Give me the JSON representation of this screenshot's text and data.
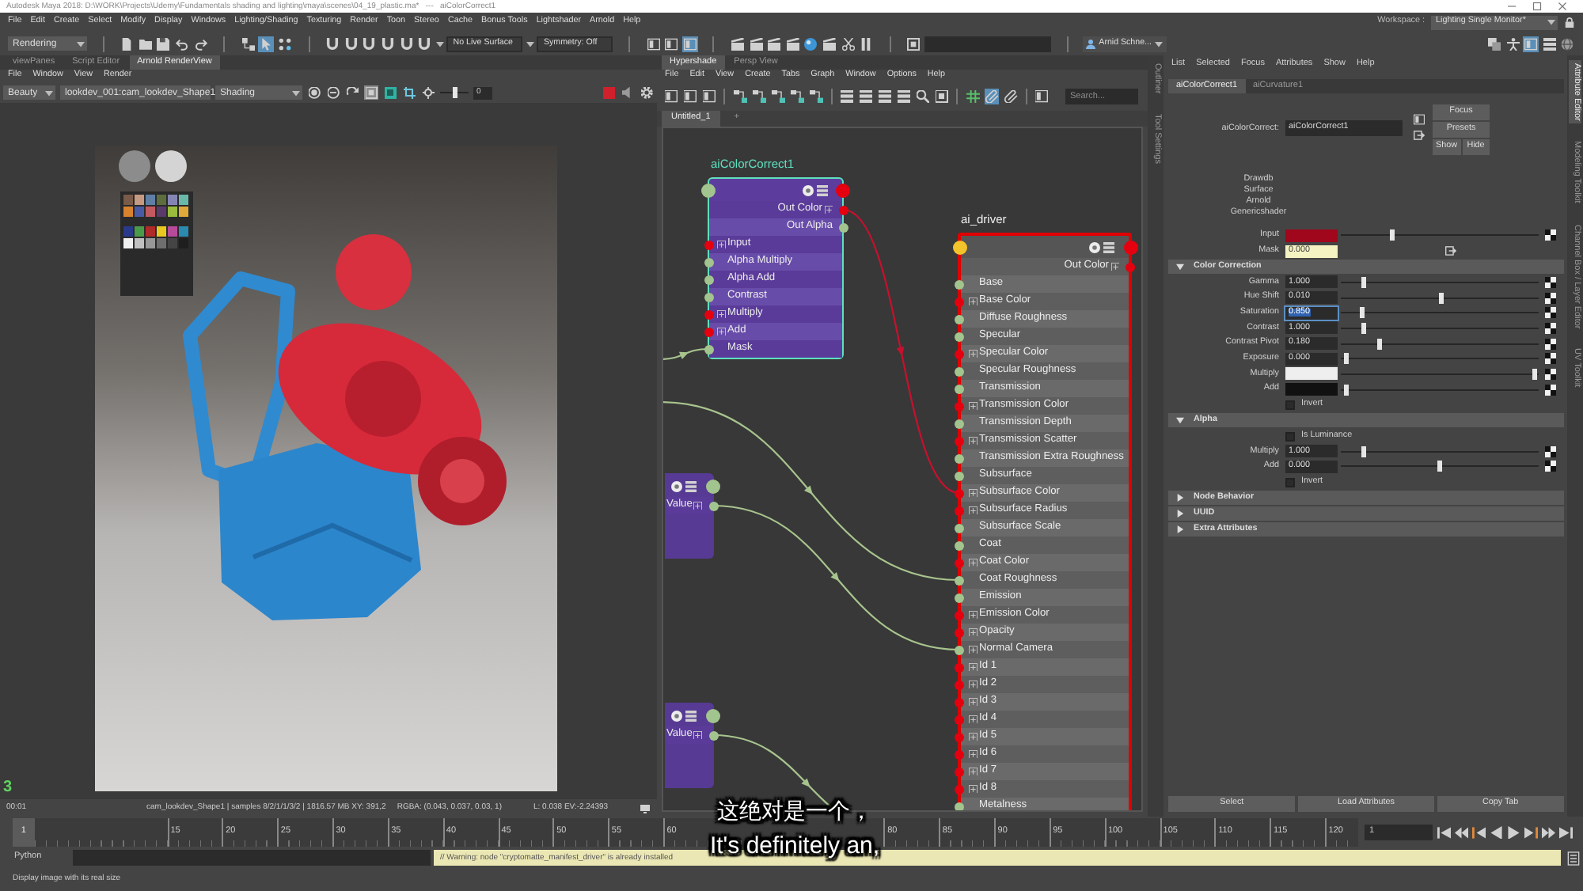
{
  "window": {
    "title": "Autodesk Maya 2018: D:\\WORK\\Projects\\Udemy\\Fundamentals shading and lighting\\maya\\scenes\\04_19_plastic.ma*   ---   aiColorCorrect1"
  },
  "menu_bar": {
    "items": [
      "File",
      "Edit",
      "Create",
      "Select",
      "Modify",
      "Display",
      "Windows",
      "Lighting/Shading",
      "Texturing",
      "Render",
      "Toon",
      "Stereo",
      "Cache",
      "Bonus Tools",
      "Lightshader",
      "Arnold",
      "Help"
    ],
    "workspace_label": "Workspace :",
    "workspace": "Lighting Single Monitor*"
  },
  "toolbar": {
    "groups": [
      [
        {
          "kind": "dropdown",
          "label": "Rendering"
        }
      ],
      [
        {
          "kind": "icon",
          "selected": false
        },
        {
          "kind": "icon",
          "selected": false
        },
        {
          "kind": "icon",
          "selected": false
        },
        {
          "kind": "icon",
          "selected": false
        },
        {
          "kind": "icon",
          "selected": false
        }
      ],
      [
        {
          "kind": "icon",
          "selected": false
        },
        {
          "kind": "icon",
          "selected": true
        },
        {
          "kind": "icon",
          "selected": false
        }
      ],
      [
        {
          "kind": "icon",
          "selected": false
        },
        {
          "kind": "icon",
          "selected": false
        },
        {
          "kind": "icon",
          "selected": false
        },
        {
          "kind": "icon",
          "selected": false
        },
        {
          "kind": "icon",
          "selected": false
        },
        {
          "kind": "icon",
          "selected": false
        },
        {
          "kind": "caret"
        },
        {
          "kind": "field",
          "value": "No Live Surface"
        },
        {
          "kind": "caret"
        },
        {
          "kind": "field",
          "value": "Symmetry: Off"
        }
      ],
      [
        {
          "kind": "icon",
          "selected": false
        },
        {
          "kind": "icon",
          "selected": false
        },
        {
          "kind": "icon",
          "selected": true
        }
      ],
      [
        {
          "kind": "icon",
          "selected": false
        },
        {
          "kind": "icon",
          "selected": false
        },
        {
          "kind": "icon",
          "selected": false
        },
        {
          "kind": "icon",
          "selected": false
        },
        {
          "kind": "icon",
          "selected": false
        },
        {
          "kind": "icon",
          "selected": false
        },
        {
          "kind": "icon",
          "selected": false
        },
        {
          "kind": "icon",
          "selected": false
        }
      ],
      [
        {
          "kind": "icon",
          "selected": false
        },
        {
          "kind": "field"
        }
      ],
      [
        {
          "kind": "account",
          "label": "Arnid Schne..."
        }
      ]
    ],
    "right_icons": [
      {
        "selected": false
      },
      {
        "selected": false
      },
      {
        "selected": true
      },
      {
        "selected": false
      },
      {
        "selected": false
      }
    ]
  },
  "render_view": {
    "tabs": [
      {
        "label": "viewPanes",
        "selected": false
      },
      {
        "label": "Script Editor",
        "selected": false
      },
      {
        "label": "Arnold RenderView",
        "selected": true
      }
    ],
    "menu": [
      "File",
      "Window",
      "View",
      "Render"
    ],
    "toolbar": {
      "aov": "Beauty",
      "camera": "lookdev_001:cam_lookdev_Shape1",
      "channel": "Shading",
      "icons": [
        {
          "selected": false
        },
        {
          "selected": false
        },
        {
          "selected": false
        },
        {
          "selected": true
        },
        {
          "selected": false
        },
        {
          "selected": false
        },
        {
          "selected": false
        }
      ],
      "exposure": {
        "level": 0.5,
        "value": "0"
      },
      "end_icons": [
        {
          "selected": false
        },
        {
          "selected": false
        },
        {
          "selected": false
        }
      ]
    },
    "panel_number": "3",
    "status": {
      "time": "00:01",
      "info": "cam_lookdev_Shape1 | samples 8/2/1/1/3/2 | 1816.57 MB XY: 391,2",
      "rgba": "RGBA: (0.043, 0.037, 0.03, 1)",
      "luminance": "L: 0.038 EV:-2.24393"
    }
  },
  "hypershade": {
    "tabs": [
      {
        "label": "Hypershade",
        "selected": true
      },
      {
        "label": "Persp View",
        "selected": false
      }
    ],
    "menu": [
      "File",
      "Edit",
      "View",
      "Create",
      "Tabs",
      "Graph",
      "Window",
      "Options",
      "Help"
    ],
    "toolbar_icons": [
      {
        "selected": false
      },
      {
        "selected": false
      },
      {
        "selected": false
      },
      {
        "selected": false
      },
      {
        "selected": false
      },
      {
        "selected": false
      },
      {
        "selected": false
      },
      {
        "selected": false
      },
      {
        "selected": false
      },
      {
        "selected": false
      },
      {
        "selected": false
      },
      {
        "selected": false
      },
      {
        "selected": false
      },
      {
        "selected": false
      },
      {
        "selected": false
      },
      {
        "selected": true
      },
      {
        "selected": false
      },
      {
        "selected": false
      }
    ],
    "search": {
      "placeholder": "Search..."
    },
    "graph_tabs": [
      {
        "label": "Untitled_1",
        "selected": true
      },
      {
        "label": "+",
        "selected": false
      }
    ],
    "nodes": [
      {
        "kind": "utility",
        "title": "aiColorCorrect1",
        "color": "#5fe0bf",
        "outputs": [
          {
            "label": "Out Color",
            "kind": "color",
            "expandable": true
          },
          {
            "label": "Out Alpha",
            "kind": "float",
            "expandable": false
          }
        ],
        "inputs": [
          {
            "label": "Input",
            "kind": "color",
            "expandable": true
          },
          {
            "label": "Alpha Multiply",
            "kind": "float",
            "expandable": false
          },
          {
            "label": "Alpha Add",
            "kind": "float",
            "expandable": false
          },
          {
            "label": "Contrast",
            "kind": "float",
            "expandable": false
          },
          {
            "label": "Multiply",
            "kind": "color",
            "expandable": true
          },
          {
            "label": "Add",
            "kind": "color",
            "expandable": true
          },
          {
            "label": "Mask",
            "kind": "float",
            "expandable": false
          }
        ]
      },
      {
        "kind": "shader",
        "title": "ai_driver",
        "color": "#e00000",
        "outputs": [
          {
            "label": "Out Color",
            "kind": "color",
            "expandable": true
          }
        ],
        "inputs": [
          {
            "label": "Base",
            "kind": "float",
            "expandable": false
          },
          {
            "label": "Base Color",
            "kind": "color",
            "expandable": true
          },
          {
            "label": "Diffuse Roughness",
            "kind": "float",
            "expandable": false
          },
          {
            "label": "Specular",
            "kind": "float",
            "expandable": false
          },
          {
            "label": "Specular Color",
            "kind": "color",
            "expandable": true
          },
          {
            "label": "Specular Roughness",
            "kind": "float",
            "expandable": false
          },
          {
            "label": "Transmission",
            "kind": "float",
            "expandable": false
          },
          {
            "label": "Transmission Color",
            "kind": "color",
            "expandable": true
          },
          {
            "label": "Transmission Depth",
            "kind": "float",
            "expandable": false
          },
          {
            "label": "Transmission Scatter",
            "kind": "color",
            "expandable": true
          },
          {
            "label": "Transmission Extra Roughness",
            "kind": "float",
            "expandable": false
          },
          {
            "label": "Subsurface",
            "kind": "float",
            "expandable": false
          },
          {
            "label": "Subsurface Color",
            "kind": "color",
            "expandable": true
          },
          {
            "label": "Subsurface Radius",
            "kind": "color",
            "expandable": true
          },
          {
            "label": "Subsurface Scale",
            "kind": "float",
            "expandable": false
          },
          {
            "label": "Coat",
            "kind": "float",
            "expandable": false
          },
          {
            "label": "Coat Color",
            "kind": "color",
            "expandable": true
          },
          {
            "label": "Coat Roughness",
            "kind": "float",
            "expandable": false
          },
          {
            "label": "Emission",
            "kind": "float",
            "expandable": false
          },
          {
            "label": "Emission Color",
            "kind": "color",
            "expandable": true
          },
          {
            "label": "Opacity",
            "kind": "color",
            "expandable": true
          },
          {
            "label": "Normal Camera",
            "kind": "float",
            "expandable": true
          },
          {
            "label": "Id 1",
            "kind": "color",
            "expandable": true
          },
          {
            "label": "Id 2",
            "kind": "color",
            "expandable": true
          },
          {
            "label": "Id 3",
            "kind": "color",
            "expandable": true
          },
          {
            "label": "Id 4",
            "kind": "color",
            "expandable": true
          },
          {
            "label": "Id 5",
            "kind": "color",
            "expandable": true
          },
          {
            "label": "Id 6",
            "kind": "color",
            "expandable": true
          },
          {
            "label": "Id 7",
            "kind": "color",
            "expandable": true
          },
          {
            "label": "Id 8",
            "kind": "color",
            "expandable": true
          },
          {
            "label": "Metalness",
            "kind": "float",
            "expandable": false
          }
        ]
      },
      {
        "kind": "value",
        "outputs": [
          {
            "label": "Value",
            "kind": "float",
            "expandable": true
          }
        ]
      },
      {
        "kind": "value",
        "outputs": [
          {
            "label": "Value",
            "kind": "float",
            "expandable": true
          }
        ]
      }
    ],
    "wires": [
      {
        "kind": "float"
      },
      {
        "kind": "color"
      },
      {
        "kind": "float"
      },
      {
        "kind": "float"
      },
      {
        "kind": "float"
      }
    ],
    "side_tabs": [
      {
        "label": "Outliner",
        "selected": false
      },
      {
        "label": "Tool Settings",
        "selected": false
      }
    ]
  },
  "attribute_editor": {
    "menu": [
      "List",
      "Selected",
      "Focus",
      "Attributes",
      "Show",
      "Help"
    ],
    "tabs": [
      {
        "label": "aiColorCorrect1",
        "selected": true
      },
      {
        "label": "aiCurvature1",
        "selected": false
      }
    ],
    "node_label": "aiColorCorrect:",
    "node_name": "aiColorCorrect1",
    "buttons": [
      "Focus",
      "Presets",
      "Show",
      "Hide"
    ],
    "classification": [
      "Drawdb",
      "Surface",
      "Arnold",
      "Genericshader"
    ],
    "attributes": [
      {
        "kind": "color",
        "label": "Input",
        "color": "#a0061c",
        "level": 0.25
      },
      {
        "kind": "field",
        "label": "Mask",
        "value": "0.000",
        "connected": true
      }
    ],
    "sections": [
      {
        "title": "Color Correction",
        "expanded": true,
        "attributes": [
          {
            "kind": "float",
            "label": "Gamma",
            "value": "1.000",
            "level": 0.11,
            "focused": false
          },
          {
            "kind": "float",
            "label": "Hue Shift",
            "value": "0.010",
            "level": 0.51,
            "focused": false
          },
          {
            "kind": "float",
            "label": "Saturation",
            "value": "0.850",
            "level": 0.1,
            "focused": true
          },
          {
            "kind": "float",
            "label": "Contrast",
            "value": "1.000",
            "level": 0.11,
            "focused": false
          },
          {
            "kind": "float",
            "label": "Contrast Pivot",
            "value": "0.180",
            "level": 0.19,
            "focused": false
          },
          {
            "kind": "float",
            "label": "Exposure",
            "value": "0.000",
            "level": 0.02,
            "focused": false
          },
          {
            "kind": "color",
            "label": "Multiply",
            "color": "#efefef",
            "level": 0.99
          },
          {
            "kind": "color",
            "label": "Add",
            "color": "#111111",
            "level": 0.02
          },
          {
            "kind": "checkbox",
            "label": "Invert",
            "checked": false
          }
        ]
      },
      {
        "title": "Alpha",
        "expanded": true,
        "attributes": [
          {
            "kind": "checkbox",
            "label": "Is Luminance",
            "checked": false
          },
          {
            "kind": "float",
            "label": "Multiply",
            "value": "1.000",
            "level": 0.11,
            "focused": false
          },
          {
            "kind": "float",
            "label": "Add",
            "value": "0.000",
            "level": 0.5,
            "focused": false
          },
          {
            "kind": "checkbox",
            "label": "Invert",
            "checked": false
          }
        ]
      },
      {
        "title": "Node Behavior",
        "expanded": false
      },
      {
        "title": "UUID",
        "expanded": false
      },
      {
        "title": "Extra Attributes",
        "expanded": false
      }
    ],
    "footer_buttons": [
      "Select",
      "Load Attributes",
      "Copy Tab"
    ]
  },
  "right_tabs": [
    {
      "label": "Attribute Editor",
      "selected": true
    },
    {
      "label": "Modeling Toolkit",
      "selected": false
    },
    {
      "label": "Channel Box / Layer Editor",
      "selected": false
    },
    {
      "label": "UV Toolkit",
      "selected": false
    }
  ],
  "timeline": {
    "current_frame": "1",
    "tick_labels": [
      [
        "15",
        "20",
        "25",
        "30",
        "35",
        "40",
        "45",
        "50",
        "55",
        "60"
      ],
      [
        "80",
        "85",
        "90",
        "95",
        "100",
        "105",
        "110",
        "115",
        "120"
      ]
    ],
    "frame_field": "1"
  },
  "command_line": {
    "language": "Python",
    "output": "// Warning: node \"cryptomatte_manifest_driver\" is already installed"
  },
  "help_line": "Display image with its real size",
  "subtitles": [
    "这绝对是一个，",
    "It's definitely an,"
  ]
}
